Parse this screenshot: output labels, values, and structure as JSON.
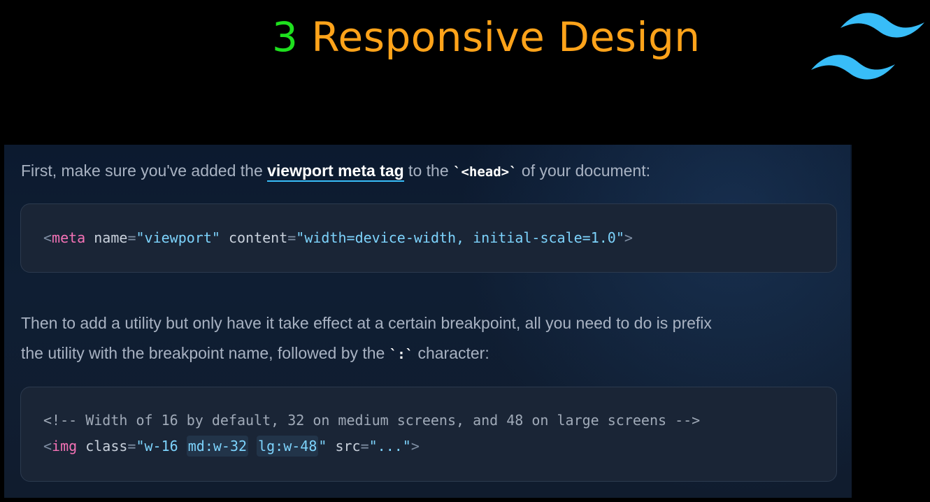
{
  "heading": {
    "number": "3",
    "text": " Responsive Design"
  },
  "logo": {
    "icon": "tailwind-logo-icon",
    "color": "#38bdf8"
  },
  "intro": {
    "before": "First, make sure you've added the ",
    "link": "viewport meta tag",
    "middle": " to the ",
    "code": "`<head>`",
    "after": " of your document:"
  },
  "code1": {
    "open": "<",
    "tag": "meta",
    "attr1": " name",
    "eq1": "=",
    "val1": "\"viewport\"",
    "attr2": "  content",
    "eq2": "=",
    "val2": "\"width=device-width, initial-scale=1.0\"",
    "close": ">"
  },
  "para2": {
    "line1": "Then to add a utility but only have it take effect at a certain breakpoint, all you need to do is prefix",
    "line2_before": "the utility with the breakpoint name, followed by the ",
    "line2_code": "`:`",
    "line2_after": " character:"
  },
  "code2": {
    "comment": "<!-- Width of 16 by default, 32 on medium screens, and 48 on large screens -->",
    "open": "<",
    "tag": "img",
    "attr1": " class",
    "eq1": "=",
    "quote_open": "\"",
    "class_base": "w-16 ",
    "class_md": "md:w-32",
    "space": " ",
    "class_lg": "lg:w-48",
    "quote_close": "\"",
    "attr2": " src",
    "eq2": "=",
    "val2": "\"...\"",
    "close": ">"
  }
}
